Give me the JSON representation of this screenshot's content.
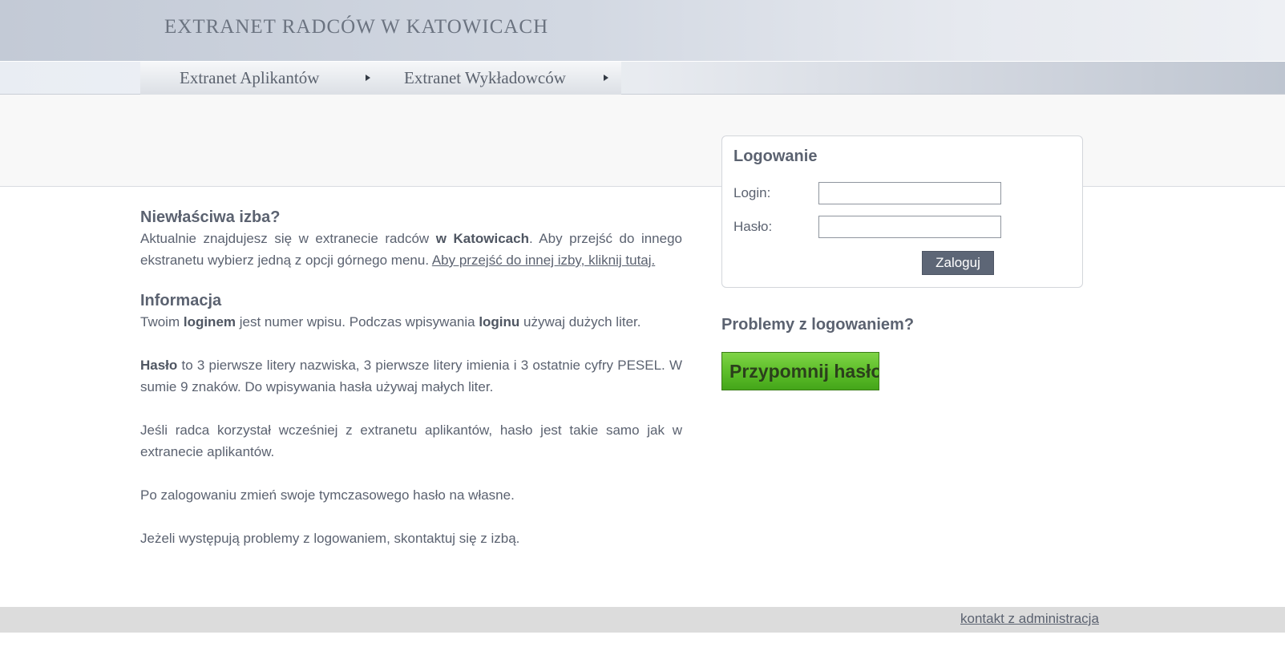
{
  "header": {
    "title": "EXTRANET RADCÓW W KATOWICACH"
  },
  "nav": {
    "items": [
      {
        "label": "Extranet Aplikantów"
      },
      {
        "label": "Extranet Wykładowców"
      }
    ]
  },
  "login": {
    "title": "Logowanie",
    "login_label": "Login:",
    "password_label": "Hasło:",
    "login_value": "",
    "password_value": "",
    "submit_label": "Zaloguj"
  },
  "problems": {
    "title": "Problemy z logowaniem?",
    "remind_label": "Przypomnij hasło"
  },
  "content": {
    "wrong_chamber": {
      "title": "Niewłaściwa izba?",
      "text_before": "Aktualnie znajdujesz się w extranecie radców ",
      "text_bold": "w Katowicach",
      "text_after": ". Aby przejść do innego ekstranetu wybierz jedną z opcji górnego menu. ",
      "link": "Aby przejść do innej izby, kliknij tutaj."
    },
    "info": {
      "title": "Informacja",
      "p1_a": "Twoim ",
      "p1_b": "loginem",
      "p1_c": " jest numer wpisu. Podczas wpisywania ",
      "p1_d": "loginu",
      "p1_e": " używaj dużych liter.",
      "p2_a": "Hasło",
      "p2_b": " to 3 pierwsze litery nazwiska, 3 pierwsze litery imienia i 3 ostatnie cyfry PESEL. W sumie 9 znaków. Do wpisywania hasła używaj małych liter.",
      "p3": "Jeśli radca korzystał wcześniej z extranetu aplikantów, hasło jest takie samo jak w extranecie aplikantów.",
      "p4": "Po zalogowaniu zmień swoje tymczasowego hasło na własne.",
      "p5": "Jeżeli występują problemy z logowaniem, skontaktuj się z izbą."
    }
  },
  "footer": {
    "link": "kontakt z administracja"
  }
}
